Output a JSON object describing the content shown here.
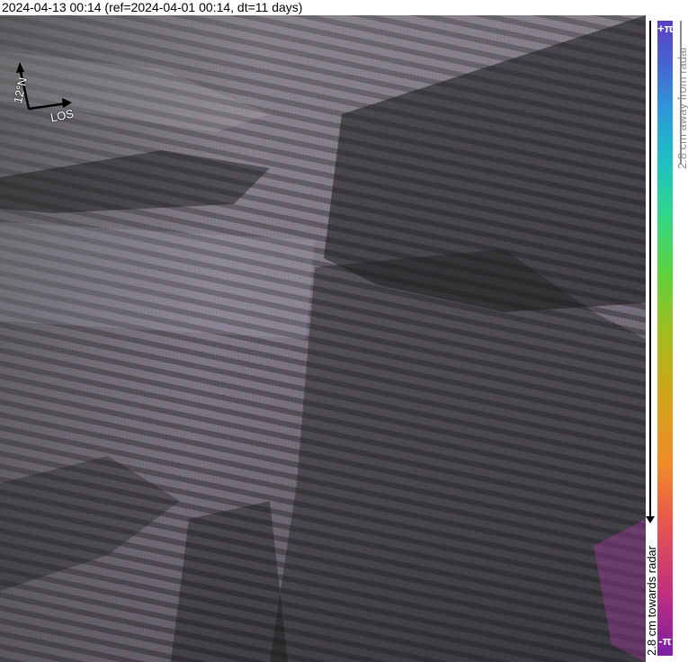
{
  "header": {
    "title": "2024-04-13 00:14 (ref=2024-04-01 00:14, dt=11 days)"
  },
  "map": {
    "north_arrow": {
      "heading_label": "12°N",
      "los_label": "LOS"
    }
  },
  "colorbar": {
    "top_label": "+π",
    "bottom_label": "-π",
    "away_label": "2.8 cm away from radar",
    "towards_label": "2.8 cm towards radar",
    "colors": [
      "#7a1fa2",
      "#c22f7e",
      "#ea5b4a",
      "#f08a2a",
      "#d3a31b",
      "#a8bb1e",
      "#5fd13b",
      "#2fd68e",
      "#1ebfc4",
      "#2e98d8",
      "#4a5fd0",
      "#5a3fc4"
    ]
  }
}
